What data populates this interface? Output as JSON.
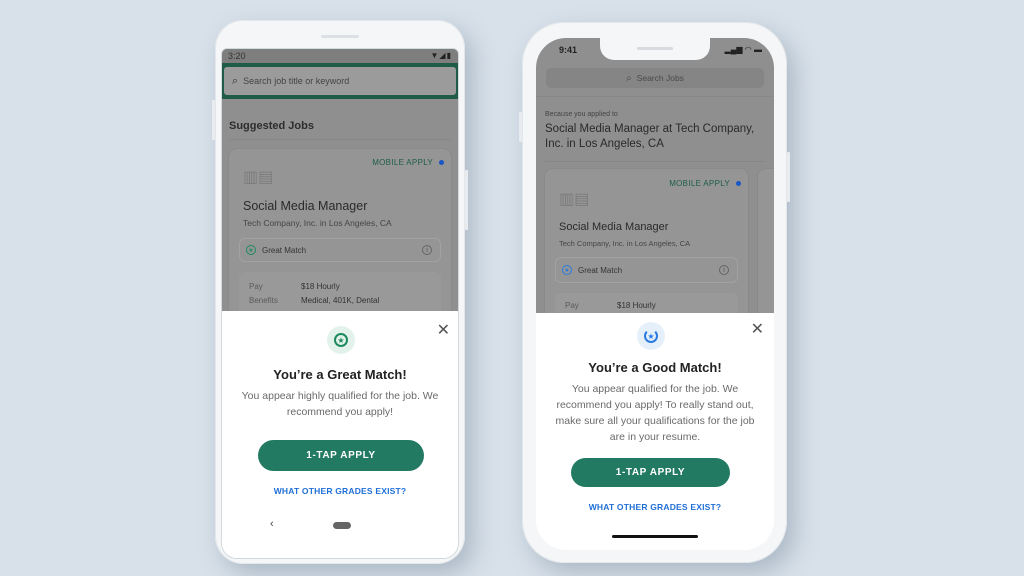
{
  "android": {
    "status": {
      "time": "3:20",
      "icons": "wifi-icon signal-icon battery-icon"
    },
    "search": {
      "placeholder": "Search job title or keyword",
      "icon": "search-icon"
    },
    "section_title": "Suggested Jobs",
    "card": {
      "mobile_apply": "MOBILE APPLY",
      "job_title": "Social Media Manager",
      "company": "Tech Company, Inc. in Los Angeles, CA",
      "match_label": "Great Match",
      "details": [
        {
          "key": "Pay",
          "value": "$18 Hourly"
        },
        {
          "key": "Benefits",
          "value": "Medical, 401K, Dental"
        }
      ]
    },
    "sheet": {
      "title": "You’re a Great Match!",
      "body": "You appear highly qualified for the job. We recommend you apply!",
      "apply_label": "1-TAP APPLY",
      "grades_link": "WHAT OTHER GRADES EXIST?",
      "badge_color": "#1e8a5e"
    },
    "nav": {
      "back": "‹"
    }
  },
  "iphone": {
    "status": {
      "time": "9:41",
      "icons": "signal-icon wifi-icon battery-icon"
    },
    "search": {
      "placeholder": "Search Jobs",
      "icon": "search-icon"
    },
    "because_label": "Because you applied to",
    "because_title": "Social Media Manager at Tech Company, Inc. in Los Angeles, CA",
    "card": {
      "mobile_apply": "MOBILE APPLY",
      "job_title": "Social Media Manager",
      "company": "Tech Company, Inc. in Los Angeles, CA",
      "match_label": "Great Match",
      "details": [
        {
          "key": "Pay",
          "value": "$18 Hourly"
        }
      ]
    },
    "sheet": {
      "title": "You’re a Good Match!",
      "body": "You appear qualified for the job. We recommend you apply! To really stand out, make sure all your qualifications for the job are in your resume.",
      "apply_label": "1-TAP APPLY",
      "grades_link": "WHAT OTHER GRADES EXIST?",
      "badge_color": "#2a7be0"
    }
  },
  "colors": {
    "background": "#d8e1ea",
    "primary_green": "#237a62",
    "link_blue": "#1f6fd6",
    "mobile_apply_dot": "#1a56c4"
  }
}
